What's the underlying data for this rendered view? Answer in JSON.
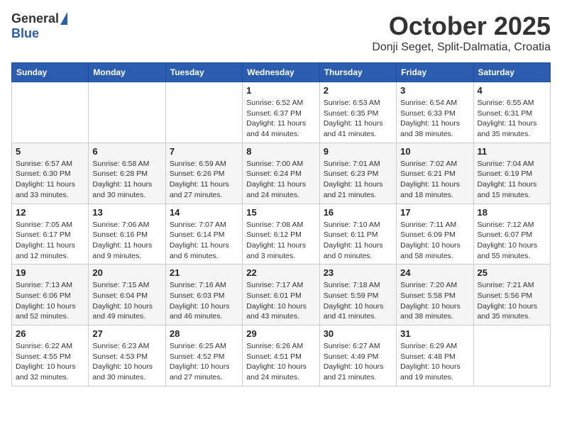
{
  "header": {
    "logo_general": "General",
    "logo_blue": "Blue",
    "month": "October 2025",
    "location": "Donji Seget, Split-Dalmatia, Croatia"
  },
  "weekdays": [
    "Sunday",
    "Monday",
    "Tuesday",
    "Wednesday",
    "Thursday",
    "Friday",
    "Saturday"
  ],
  "weeks": [
    [
      {
        "day": "",
        "info": ""
      },
      {
        "day": "",
        "info": ""
      },
      {
        "day": "",
        "info": ""
      },
      {
        "day": "1",
        "info": "Sunrise: 6:52 AM\nSunset: 6:37 PM\nDaylight: 11 hours and 44 minutes."
      },
      {
        "day": "2",
        "info": "Sunrise: 6:53 AM\nSunset: 6:35 PM\nDaylight: 11 hours and 41 minutes."
      },
      {
        "day": "3",
        "info": "Sunrise: 6:54 AM\nSunset: 6:33 PM\nDaylight: 11 hours and 38 minutes."
      },
      {
        "day": "4",
        "info": "Sunrise: 6:55 AM\nSunset: 6:31 PM\nDaylight: 11 hours and 35 minutes."
      }
    ],
    [
      {
        "day": "5",
        "info": "Sunrise: 6:57 AM\nSunset: 6:30 PM\nDaylight: 11 hours and 33 minutes."
      },
      {
        "day": "6",
        "info": "Sunrise: 6:58 AM\nSunset: 6:28 PM\nDaylight: 11 hours and 30 minutes."
      },
      {
        "day": "7",
        "info": "Sunrise: 6:59 AM\nSunset: 6:26 PM\nDaylight: 11 hours and 27 minutes."
      },
      {
        "day": "8",
        "info": "Sunrise: 7:00 AM\nSunset: 6:24 PM\nDaylight: 11 hours and 24 minutes."
      },
      {
        "day": "9",
        "info": "Sunrise: 7:01 AM\nSunset: 6:23 PM\nDaylight: 11 hours and 21 minutes."
      },
      {
        "day": "10",
        "info": "Sunrise: 7:02 AM\nSunset: 6:21 PM\nDaylight: 11 hours and 18 minutes."
      },
      {
        "day": "11",
        "info": "Sunrise: 7:04 AM\nSunset: 6:19 PM\nDaylight: 11 hours and 15 minutes."
      }
    ],
    [
      {
        "day": "12",
        "info": "Sunrise: 7:05 AM\nSunset: 6:17 PM\nDaylight: 11 hours and 12 minutes."
      },
      {
        "day": "13",
        "info": "Sunrise: 7:06 AM\nSunset: 6:16 PM\nDaylight: 11 hours and 9 minutes."
      },
      {
        "day": "14",
        "info": "Sunrise: 7:07 AM\nSunset: 6:14 PM\nDaylight: 11 hours and 6 minutes."
      },
      {
        "day": "15",
        "info": "Sunrise: 7:08 AM\nSunset: 6:12 PM\nDaylight: 11 hours and 3 minutes."
      },
      {
        "day": "16",
        "info": "Sunrise: 7:10 AM\nSunset: 6:11 PM\nDaylight: 11 hours and 0 minutes."
      },
      {
        "day": "17",
        "info": "Sunrise: 7:11 AM\nSunset: 6:09 PM\nDaylight: 10 hours and 58 minutes."
      },
      {
        "day": "18",
        "info": "Sunrise: 7:12 AM\nSunset: 6:07 PM\nDaylight: 10 hours and 55 minutes."
      }
    ],
    [
      {
        "day": "19",
        "info": "Sunrise: 7:13 AM\nSunset: 6:06 PM\nDaylight: 10 hours and 52 minutes."
      },
      {
        "day": "20",
        "info": "Sunrise: 7:15 AM\nSunset: 6:04 PM\nDaylight: 10 hours and 49 minutes."
      },
      {
        "day": "21",
        "info": "Sunrise: 7:16 AM\nSunset: 6:03 PM\nDaylight: 10 hours and 46 minutes."
      },
      {
        "day": "22",
        "info": "Sunrise: 7:17 AM\nSunset: 6:01 PM\nDaylight: 10 hours and 43 minutes."
      },
      {
        "day": "23",
        "info": "Sunrise: 7:18 AM\nSunset: 5:59 PM\nDaylight: 10 hours and 41 minutes."
      },
      {
        "day": "24",
        "info": "Sunrise: 7:20 AM\nSunset: 5:58 PM\nDaylight: 10 hours and 38 minutes."
      },
      {
        "day": "25",
        "info": "Sunrise: 7:21 AM\nSunset: 5:56 PM\nDaylight: 10 hours and 35 minutes."
      }
    ],
    [
      {
        "day": "26",
        "info": "Sunrise: 6:22 AM\nSunset: 4:55 PM\nDaylight: 10 hours and 32 minutes."
      },
      {
        "day": "27",
        "info": "Sunrise: 6:23 AM\nSunset: 4:53 PM\nDaylight: 10 hours and 30 minutes."
      },
      {
        "day": "28",
        "info": "Sunrise: 6:25 AM\nSunset: 4:52 PM\nDaylight: 10 hours and 27 minutes."
      },
      {
        "day": "29",
        "info": "Sunrise: 6:26 AM\nSunset: 4:51 PM\nDaylight: 10 hours and 24 minutes."
      },
      {
        "day": "30",
        "info": "Sunrise: 6:27 AM\nSunset: 4:49 PM\nDaylight: 10 hours and 21 minutes."
      },
      {
        "day": "31",
        "info": "Sunrise: 6:29 AM\nSunset: 4:48 PM\nDaylight: 10 hours and 19 minutes."
      },
      {
        "day": "",
        "info": ""
      }
    ]
  ]
}
